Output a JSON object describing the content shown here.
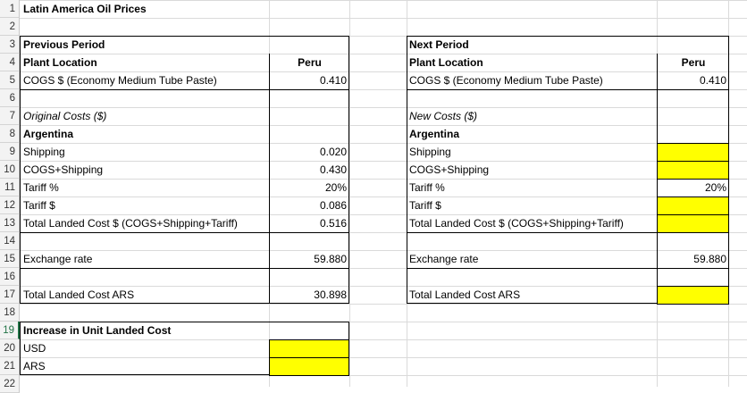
{
  "rows": [
    "1",
    "2",
    "3",
    "4",
    "5",
    "6",
    "7",
    "8",
    "9",
    "10",
    "11",
    "12",
    "13",
    "14",
    "15",
    "16",
    "17",
    "18",
    "19",
    "20",
    "21",
    "22"
  ],
  "title": "Latin America Oil Prices",
  "left": {
    "previous_period": "Previous Period",
    "plant_location": "Plant Location",
    "plant_value": "Peru",
    "cogs_label": "COGS $ (Economy Medium Tube Paste)",
    "cogs_value": "0.410",
    "original_costs": "Original Costs ($)",
    "argentina": "Argentina",
    "shipping": "Shipping",
    "shipping_value": "0.020",
    "cogs_shipping": "COGS+Shipping",
    "cogs_shipping_value": "0.430",
    "tariff_pct": "Tariff %",
    "tariff_pct_value": "20%",
    "tariff_dollar": "Tariff $",
    "tariff_dollar_value": "0.086",
    "total_landed": "Total Landed Cost $ (COGS+Shipping+Tariff)",
    "total_landed_value": "0.516",
    "exchange_rate": "Exchange rate",
    "exchange_rate_value": "59.880",
    "total_ars": "Total Landed Cost ARS",
    "total_ars_value": "30.898",
    "increase": "Increase in Unit Landed Cost",
    "usd": "USD",
    "ars": "ARS"
  },
  "right": {
    "next_period": "Next Period",
    "plant_location": "Plant Location",
    "plant_value": "Peru",
    "cogs_label": "COGS $ (Economy Medium Tube Paste)",
    "cogs_value": "0.410",
    "new_costs": "New Costs ($)",
    "argentina": "Argentina",
    "shipping": "Shipping",
    "cogs_shipping": "COGS+Shipping",
    "tariff_pct": "Tariff %",
    "tariff_pct_value": "20%",
    "tariff_dollar": "Tariff $",
    "total_landed": "Total Landed Cost $ (COGS+Shipping+Tariff)",
    "exchange_rate": "Exchange rate",
    "exchange_rate_value": "59.880",
    "total_ars": "Total Landed Cost ARS"
  },
  "colors": {
    "highlight": "#ffff00",
    "grid": "#dadada",
    "selected_row": "#217346"
  }
}
